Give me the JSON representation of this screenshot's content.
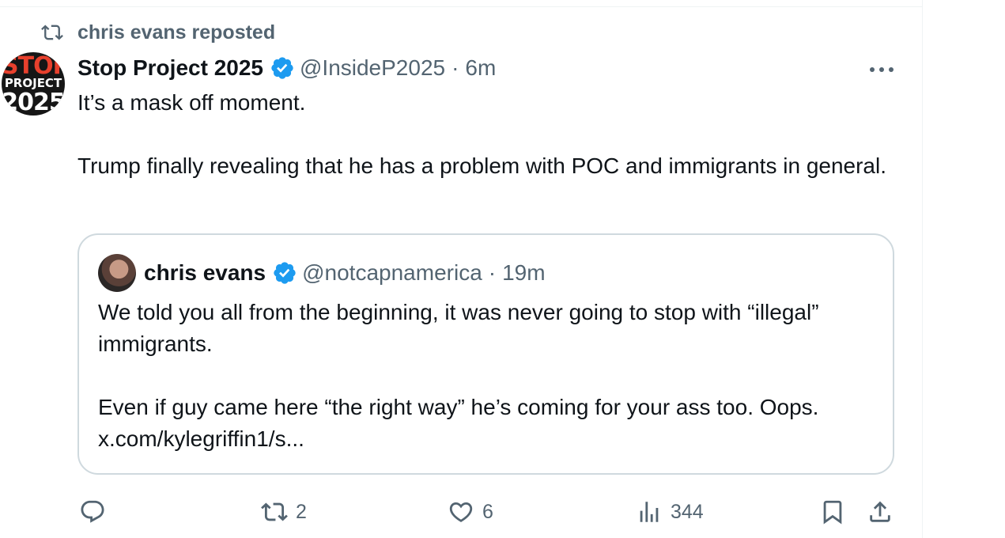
{
  "repost_context": {
    "label": "chris evans reposted"
  },
  "tweet": {
    "author_name": "Stop Project 2025",
    "author_handle": "@InsideP2025",
    "separator": "·",
    "time": "6m",
    "avatar_text": {
      "line1": "STOP",
      "line2": "PROJECT",
      "line3": "2025"
    },
    "text_lines": [
      "It’s a mask off moment.",
      "Trump finally revealing that he has a problem with POC and immigrants in general."
    ]
  },
  "quote": {
    "author_name": "chris evans",
    "author_handle": "@notcapnamerica",
    "separator": "·",
    "time": "19m",
    "text_lines": [
      "We told you all from the beginning, it was never going to stop with “illegal” immigrants.",
      "Even if guy came here “the right way” he’s coming for your ass too. Oops. x.com/kylegriffin1/s..."
    ]
  },
  "actions": {
    "reply_count": "",
    "repost_count": "2",
    "like_count": "6",
    "views_count": "344"
  },
  "icons": {
    "repost_context": "repost-icon",
    "verified": "verified-badge-icon",
    "more": "more-options-icon",
    "reply": "reply-icon",
    "repost": "repost-icon",
    "like": "heart-icon",
    "views": "views-chart-icon",
    "bookmark": "bookmark-icon",
    "share": "share-icon"
  },
  "colors": {
    "accent": "#1d9bf0",
    "secondary_text": "#536471",
    "border": "#cfd9de"
  }
}
